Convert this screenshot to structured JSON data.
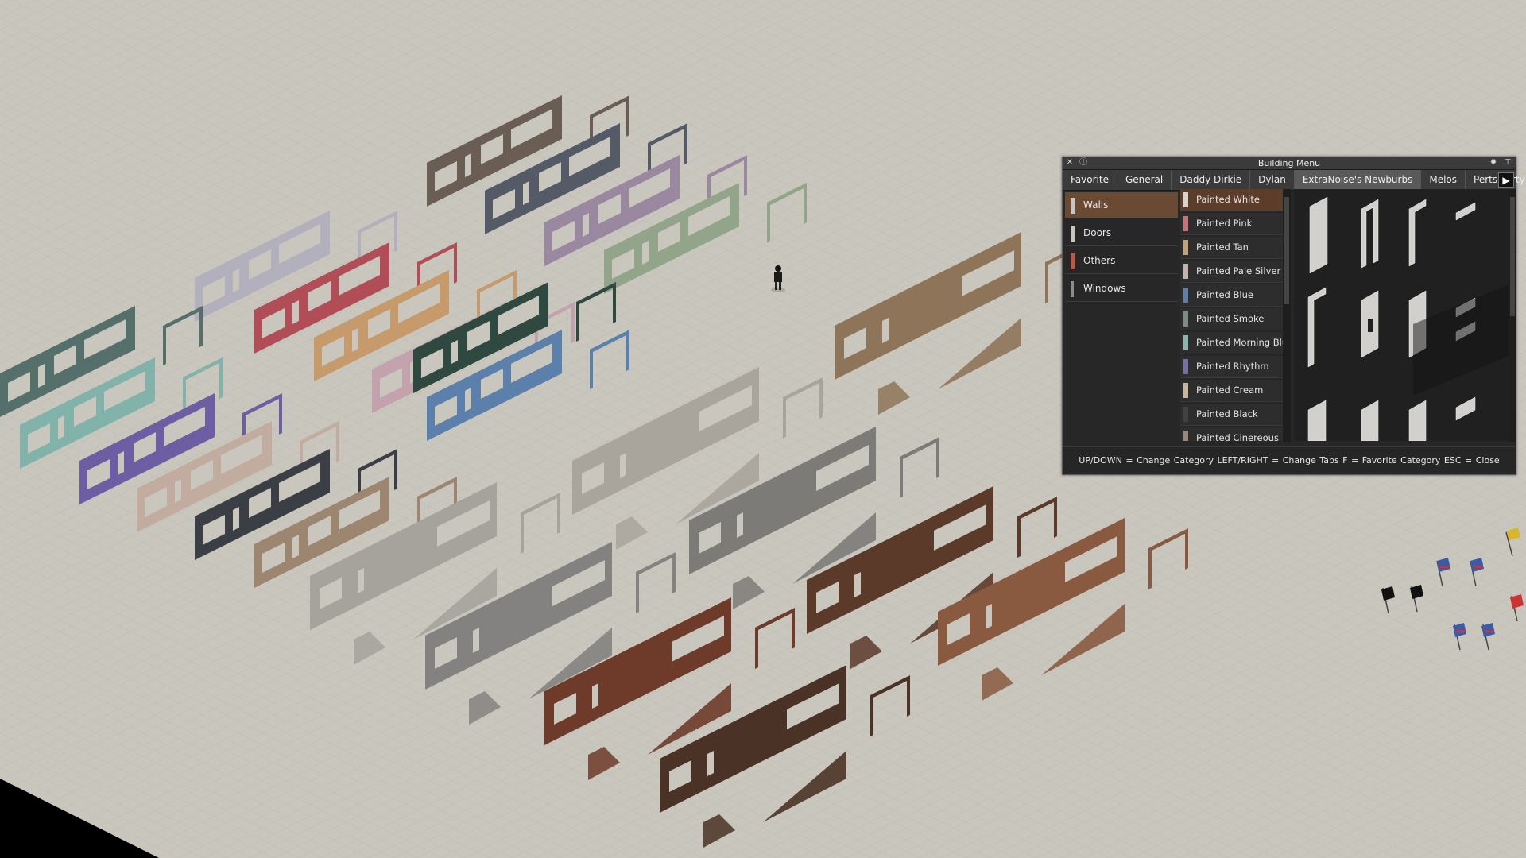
{
  "menu": {
    "title": "Building Menu",
    "tabs": [
      "Favorite",
      "General",
      "Daddy Dirkie",
      "Dylan",
      "ExtraNoise's Newburbs",
      "Melos",
      "Perts Party"
    ],
    "active_tab": "ExtraNoise's Newburbs",
    "categories": [
      {
        "label": "Walls",
        "color": "#cfccc6"
      },
      {
        "label": "Doors",
        "color": "#cfccc6"
      },
      {
        "label": "Others",
        "color": "#b65a4a"
      },
      {
        "label": "Windows",
        "color": "#8c8c8c"
      }
    ],
    "items": [
      {
        "label": "Painted White",
        "color": "#d8d4cc"
      },
      {
        "label": "Painted Pink",
        "color": "#c9727a"
      },
      {
        "label": "Painted Tan",
        "color": "#c4a07c"
      },
      {
        "label": "Painted Pale Silver",
        "color": "#c3b1ae"
      },
      {
        "label": "Painted Blue",
        "color": "#5e80a8"
      },
      {
        "label": "Painted Smoke",
        "color": "#7f8b86"
      },
      {
        "label": "Painted Morning Blu",
        "color": "#8ab5ad"
      },
      {
        "label": "Painted Rhythm",
        "color": "#7a6ea4"
      },
      {
        "label": "Painted Cream",
        "color": "#c7b79b"
      },
      {
        "label": "Painted Black",
        "color": "#424242"
      },
      {
        "label": "Painted Cinereous",
        "color": "#9a887a"
      }
    ],
    "footer": "UP/DOWN = Change Category   LEFT/RIGHT = Change Tabs   F = Favorite Category   ESC = Close"
  },
  "world": {
    "wall_colors": [
      "#6a5e54",
      "#555b66",
      "#9a88a0",
      "#92a58a",
      "#b2b0bd",
      "#b04d57",
      "#c79a6c",
      "#c3a1ad",
      "#5b80ab",
      "#55706b",
      "#82b3ab",
      "#6d5ea3",
      "#c2aca0",
      "#3b3f45",
      "#9c8670",
      "#2f4940"
    ],
    "plank_colors": [
      "#8e7458",
      "#a9a49c",
      "#7d7b78",
      "#5c3a2a",
      "#a6a29c",
      "#848280",
      "#6e3b2a",
      "#8a5a40",
      "#4a3326"
    ]
  }
}
